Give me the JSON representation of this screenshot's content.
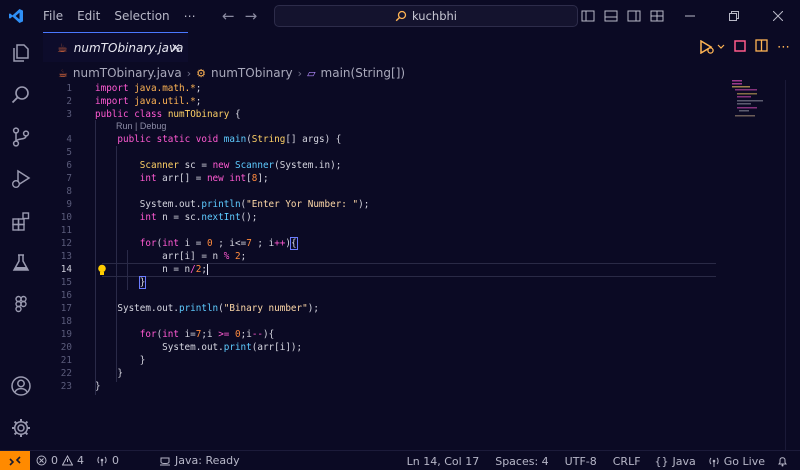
{
  "menu": [
    "File",
    "Edit",
    "Selection",
    "⋯"
  ],
  "search": {
    "text": "kuchbhi"
  },
  "tab": {
    "filename": "numTObinary.java",
    "close_glyph": "✕"
  },
  "breadcrumb": [
    "numTObinary.java",
    "numTObinary",
    "main(String[])"
  ],
  "codelens": "Run | Debug",
  "line_numbers": [
    "1",
    "2",
    "3",
    "4",
    "5",
    "6",
    "7",
    "8",
    "9",
    "10",
    "11",
    "12",
    "13",
    "14",
    "15",
    "16",
    "17",
    "18",
    "19",
    "20",
    "21",
    "22",
    "23"
  ],
  "current_line": "14",
  "status": {
    "errors": "0",
    "warnings": "4",
    "ports": "0",
    "java": "Java: Ready",
    "position": "Ln 14, Col 17",
    "spaces": "Spaces: 4",
    "encoding": "UTF-8",
    "eol": "CRLF",
    "language": "Java",
    "golive": "Go Live"
  },
  "colors": {
    "background": "#0b0a24",
    "keyword": "#ff5ad2",
    "class": "#ffd166",
    "string": "#ffd9a8",
    "number": "#ff8a3d",
    "function": "#5ecbff",
    "remote_button": "#ff8a00",
    "tab_accent": "#4a78ff"
  },
  "icons": [
    "vscode-logo",
    "explorer-icon",
    "search-icon",
    "source-control-icon",
    "run-debug-icon",
    "extensions-icon",
    "testing-icon",
    "figma-icon",
    "account-icon",
    "settings-gear-icon"
  ]
}
